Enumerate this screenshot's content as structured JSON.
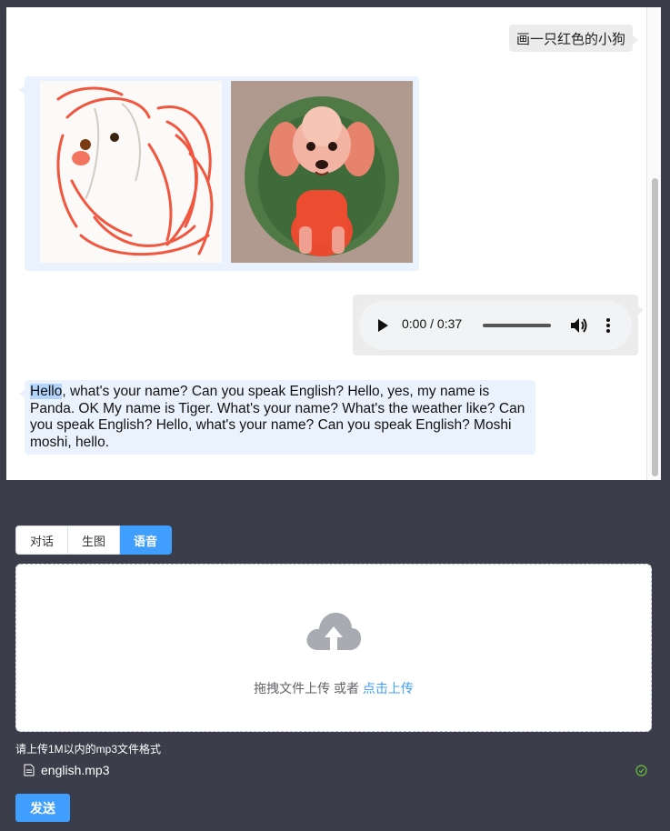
{
  "chat": {
    "user_prompt": "画一只红色的小狗",
    "images": [
      {
        "alt": "sketchy red dog drawing"
      },
      {
        "alt": "painted red poodle on green background"
      }
    ],
    "audio": {
      "time": "0:00 / 0:37",
      "progress": 0
    },
    "transcript_highlight": "Hello",
    "transcript_rest": ", what's your name? Can you speak English? Hello, yes, my name is Panda. OK My name is Tiger. What's your name? What's the weather like? Can you speak English? Hello, what's your name? Can you speak English? Moshi moshi, hello."
  },
  "tabs": [
    {
      "label": "对话",
      "active": false
    },
    {
      "label": "生图",
      "active": false
    },
    {
      "label": "语音",
      "active": true
    }
  ],
  "upload": {
    "drop_text": "拖拽文件上传 或者 ",
    "drop_link": "点击上传",
    "tip": "请上传1M以内的mp3文件格式"
  },
  "file": {
    "name": "english.mp3",
    "status": "success"
  },
  "send_label": "发送",
  "colors": {
    "accent": "#409eff",
    "background": "#3c3d4a",
    "user_bubble": "#ececec",
    "bot_bubble": "#eaf3fd"
  }
}
